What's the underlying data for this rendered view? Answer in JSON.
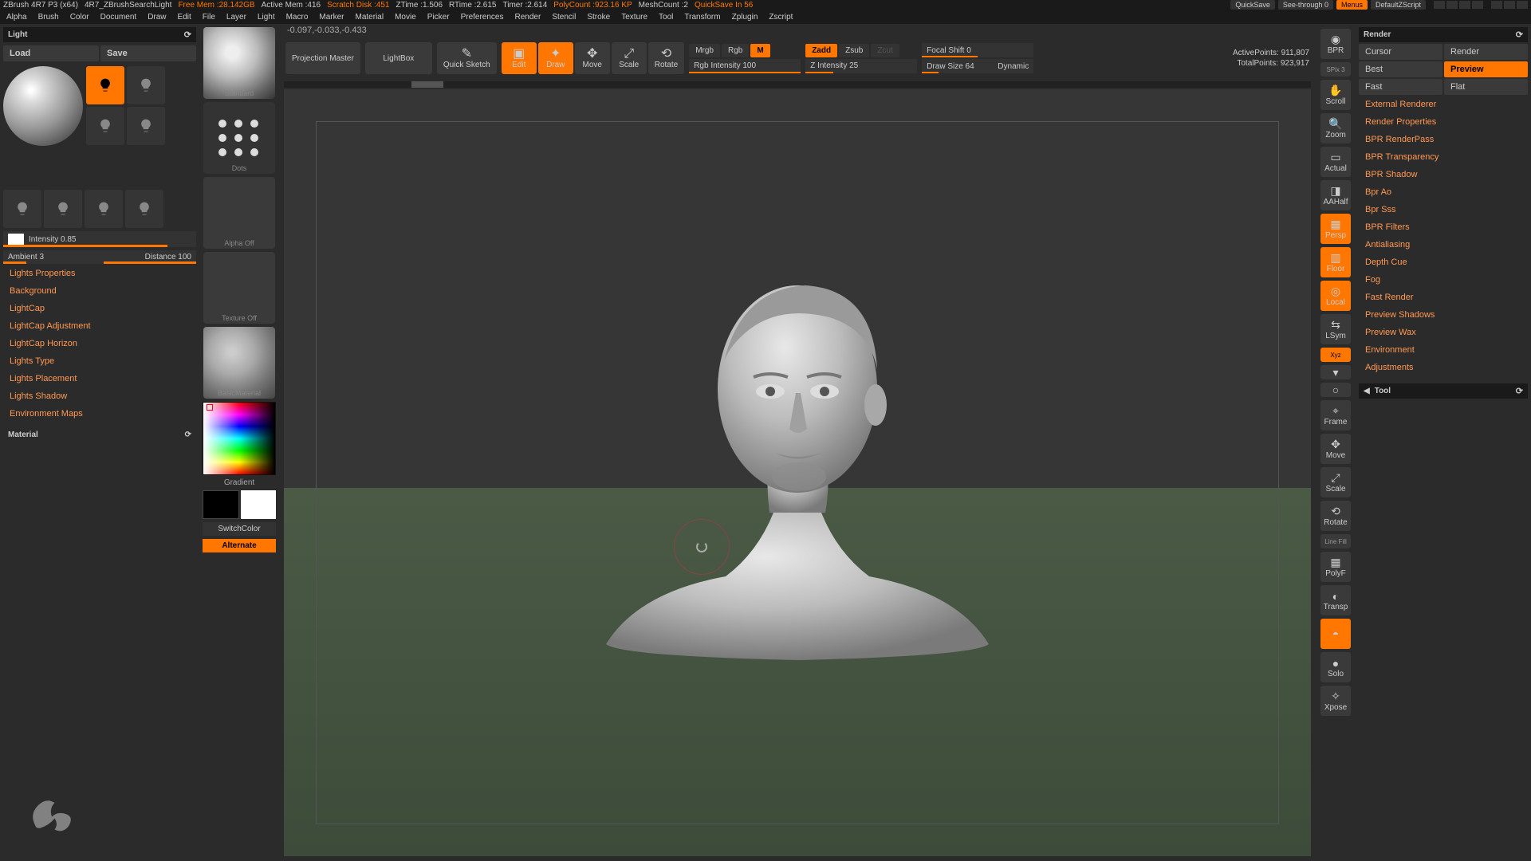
{
  "titlebar": {
    "app": "ZBrush 4R7 P3 (x64)",
    "doc": "4R7_ZBrushSearchLight",
    "freemem": "Free Mem :28.142GB",
    "activemem": "Active Mem :416",
    "scratch": "Scratch Disk :451",
    "ztime": "ZTime :1.506",
    "rtime": "RTime :2.615",
    "timer": "Timer :2.614",
    "polycount": "PolyCount :923.16 KP",
    "meshcount": "MeshCount :2",
    "quicksave_in": "QuickSave In 56",
    "quicksave": "QuickSave",
    "seethrough": "See-through  0",
    "menus": "Menus",
    "layout": "DefaultZScript"
  },
  "menu": [
    "Alpha",
    "Brush",
    "Color",
    "Document",
    "Draw",
    "Edit",
    "File",
    "Layer",
    "Light",
    "Macro",
    "Marker",
    "Material",
    "Movie",
    "Picker",
    "Preferences",
    "Render",
    "Stencil",
    "Stroke",
    "Texture",
    "Tool",
    "Transform",
    "Zplugin",
    "Zscript"
  ],
  "left": {
    "light_title": "Light",
    "load": "Load",
    "save": "Save",
    "intensity": "Intensity 0.85",
    "ambient": "Ambient 3",
    "distance": "Distance 100",
    "props": [
      "Lights Properties",
      "Background",
      "LightCap",
      "LightCap Adjustment",
      "LightCap Horizon",
      "Lights Type",
      "Lights Placement",
      "Lights Shadow",
      "Environment Maps"
    ],
    "material_title": "Material"
  },
  "strip": {
    "standard": "Standard",
    "dots": "Dots",
    "alpha": "Alpha  Off",
    "texture": "Texture  Off",
    "basicmat": "BasicMaterial",
    "gradient": "Gradient",
    "switchcolor": "SwitchColor",
    "alternate": "Alternate"
  },
  "coords": "-0.097,-0.033,-0.433",
  "toolbar": {
    "projection": "Projection Master",
    "lightbox": "LightBox",
    "quicksketch": "Quick Sketch",
    "edit": "Edit",
    "draw": "Draw",
    "move": "Move",
    "scale": "Scale",
    "rotate": "Rotate",
    "mrgb": "Mrgb",
    "rgb": "Rgb",
    "m": "M",
    "rgb_int": "Rgb Intensity 100",
    "zadd": "Zadd",
    "zsub": "Zsub",
    "zcut": "Zcut",
    "z_int": "Z Intensity 25",
    "focal": "Focal Shift 0",
    "drawsize": "Draw Size 64",
    "dynamic": "Dynamic",
    "active": "ActivePoints: 911,807",
    "total": "TotalPoints: 923,917"
  },
  "shelf": {
    "bpr": "BPR",
    "spix": "SPix 3",
    "scroll": "Scroll",
    "zoom": "Zoom",
    "actual": "Actual",
    "aahalf": "AAHalf",
    "persp": "Persp",
    "floor": "Floor",
    "local": "Local",
    "lsym": "LSym",
    "xyz": "Xyz",
    "frame": "Frame",
    "move": "Move",
    "scale": "Scale",
    "rotate": "Rotate",
    "linefill": "Line Fill",
    "polyf": "PolyF",
    "transp": "Transp",
    "ghost": "Ghost",
    "solo": "Solo",
    "xpose": "Xpose"
  },
  "right": {
    "render_title": "Render",
    "cursor": "Cursor",
    "render": "Render",
    "best": "Best",
    "preview": "Preview",
    "fast": "Fast",
    "flat": "Flat",
    "items": [
      "External Renderer",
      "Render Properties",
      "BPR RenderPass",
      "BPR Transparency",
      "BPR Shadow",
      "Bpr Ao",
      "Bpr Sss",
      "BPR Filters",
      "Antialiasing",
      "Depth Cue",
      "Fog",
      "Fast Render",
      "Preview Shadows",
      "Preview Wax",
      "Environment",
      "Adjustments"
    ],
    "tool_title": "Tool"
  }
}
